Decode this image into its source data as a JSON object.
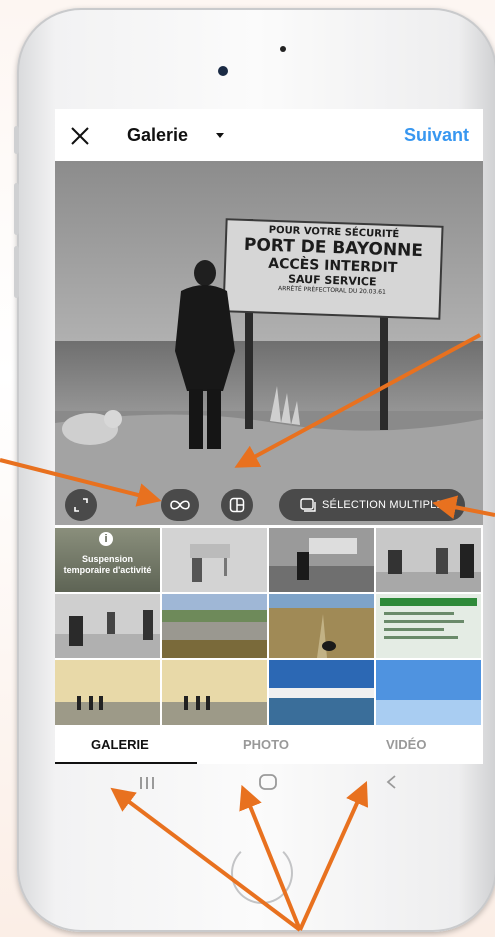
{
  "header": {
    "close_icon": "close-icon",
    "title": "Galerie",
    "next_label": "Suivant",
    "accent": "#3897f0"
  },
  "preview": {
    "sign_lines": [
      "POUR VOTRE SÉCURITÉ",
      "PORT DE BAYONNE",
      "ACCÈS INTERDIT",
      "SAUF SERVICE",
      "ARRÊTÉ PRÉFECTORAL DU 20.03.61"
    ],
    "controls": {
      "expand_icon": "expand-icon",
      "boomerang_icon": "infinity-icon",
      "layout_icon": "layout-icon",
      "multi_select_label": "SÉLECTION MULTIPLE"
    }
  },
  "grid": {
    "info_tile": {
      "icon": "info-icon",
      "line1": "Suspension",
      "line2": "temporaire d'activité"
    }
  },
  "tabs": {
    "items": [
      {
        "label": "GALERIE",
        "active": true
      },
      {
        "label": "PHOTO",
        "active": false
      },
      {
        "label": "VIDÉO",
        "active": false
      }
    ]
  },
  "navbar": {
    "recents_icon": "recents-icon",
    "home_icon": "home-icon",
    "back_icon": "back-icon"
  },
  "annotation_color": "#e8711f"
}
